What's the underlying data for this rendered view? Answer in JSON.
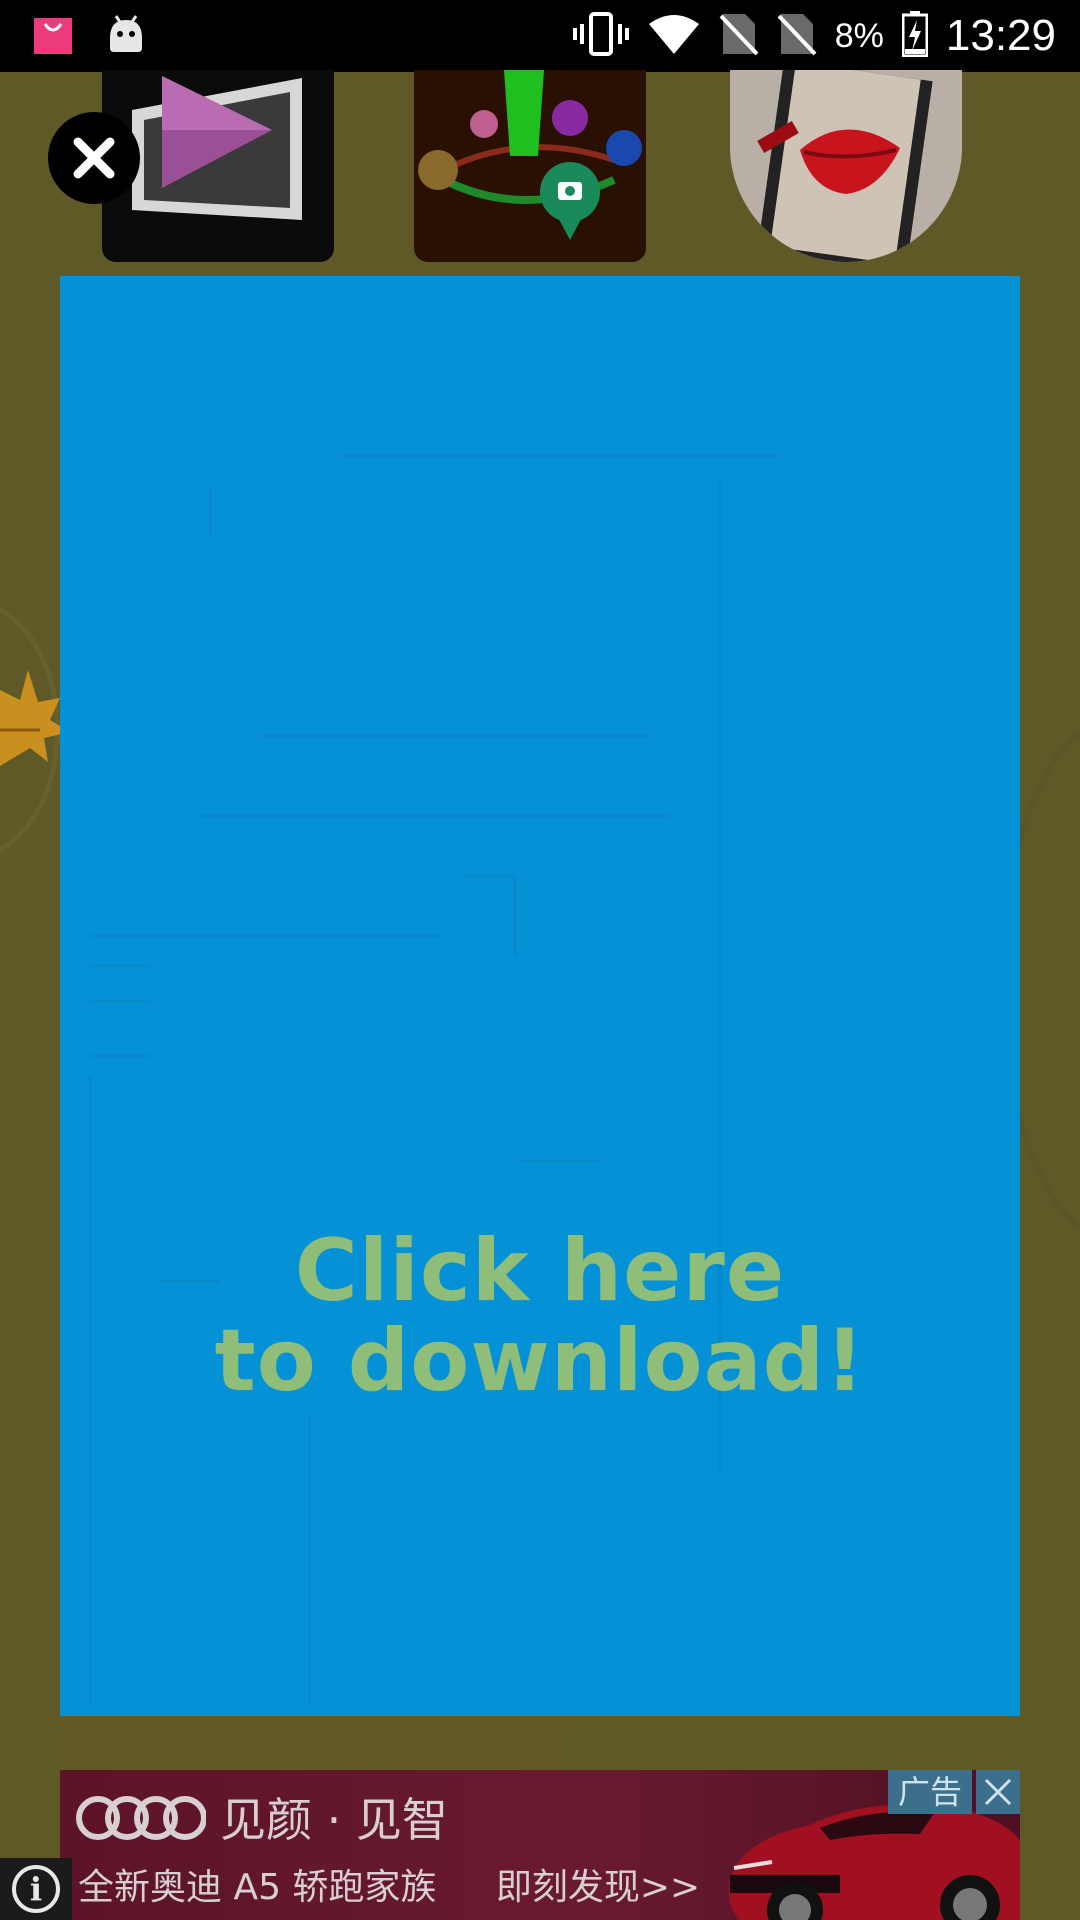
{
  "status_bar": {
    "battery": "8%",
    "time": "13:29",
    "icons": [
      "shopping-bag-icon",
      "android-icon",
      "vibrate-icon",
      "wifi-icon",
      "no-sim-icon",
      "no-sim-icon",
      "battery-charging-icon"
    ]
  },
  "background_apps": {
    "tiles": [
      {
        "name": "video-player-app",
        "icon": "play-icon"
      },
      {
        "name": "map-places-app",
        "icon": "map-pins-icon"
      },
      {
        "name": "lipstick-app",
        "icon": "lips-icon"
      }
    ]
  },
  "interstitial_ad": {
    "cta_line1": "Click here",
    "cta_line2": "to download!",
    "background_color": "#0491d6",
    "cta_color": "#8fbd7a"
  },
  "banner_ad": {
    "title": "见颜 · 见智",
    "subtitle": "全新奥迪 A5 轿跑家族",
    "cta": "即刻发现>>",
    "ad_label": "广告"
  }
}
